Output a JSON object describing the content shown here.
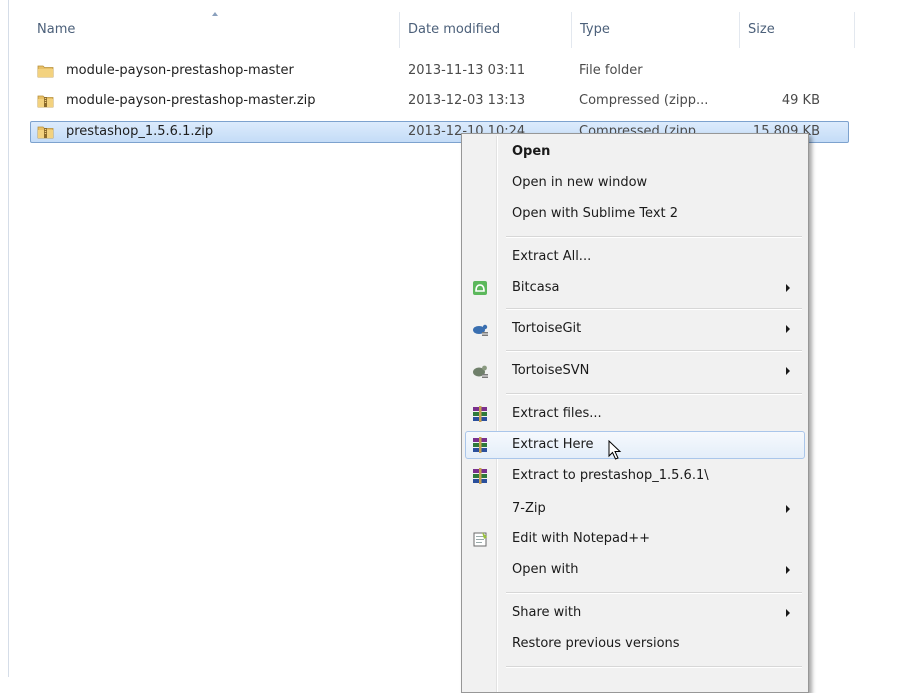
{
  "header": {
    "col_name": "Name",
    "col_date": "Date modified",
    "col_type": "Type",
    "col_size": "Size"
  },
  "files": [
    {
      "name": "module-payson-prestashop-master",
      "date": "2013-11-13 03:11",
      "type": "File folder",
      "size": "",
      "icon": "folder-icon"
    },
    {
      "name": "module-payson-prestashop-master.zip",
      "date": "2013-12-03 13:13",
      "type": "Compressed (zipp...",
      "size": "49 KB",
      "icon": "zip-folder-icon"
    },
    {
      "name": "prestashop_1.5.6.1.zip",
      "date": "2013-12-10 10:24",
      "type": "Compressed (zipp...",
      "size": "15,809 KB",
      "icon": "zip-folder-icon"
    }
  ],
  "context_menu": {
    "items": [
      {
        "label": "Open"
      },
      {
        "label": "Open in new window"
      },
      {
        "label": "Open with Sublime Text 2"
      },
      {
        "label": "Extract All..."
      },
      {
        "label": "Bitcasa"
      },
      {
        "label": "TortoiseGit"
      },
      {
        "label": "TortoiseSVN"
      },
      {
        "label": "Extract files..."
      },
      {
        "label": "Extract Here"
      },
      {
        "label": "Extract to prestashop_1.5.6.1\\"
      },
      {
        "label": "7-Zip"
      },
      {
        "label": "Edit with Notepad++"
      },
      {
        "label": "Open with"
      },
      {
        "label": "Share with"
      },
      {
        "label": "Restore previous versions"
      }
    ]
  },
  "colors": {
    "selection": "#c4dcf7",
    "selection_border": "#7da2ce",
    "menu_bg": "#f1f1f1",
    "hover_border": "#aac6ea",
    "header_text": "#4c607a"
  }
}
